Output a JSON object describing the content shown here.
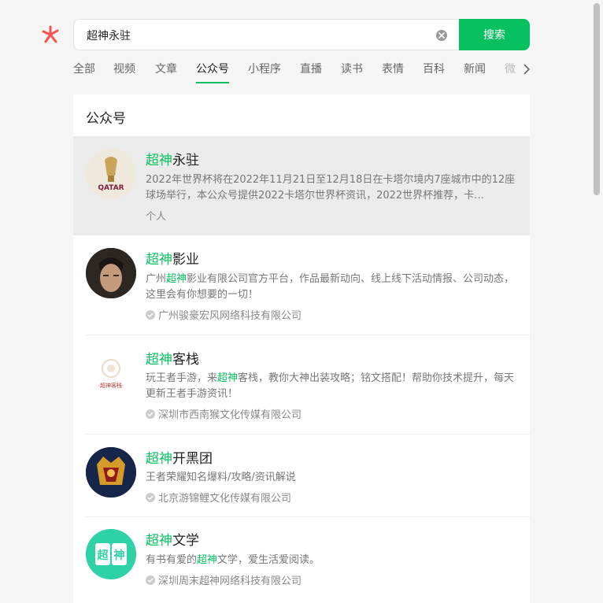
{
  "search": {
    "query": "超神永驻",
    "button_label": "搜索"
  },
  "tabs": [
    {
      "label": "全部"
    },
    {
      "label": "视频"
    },
    {
      "label": "文章"
    },
    {
      "label": "公众号",
      "active": true
    },
    {
      "label": "小程序"
    },
    {
      "label": "直播"
    },
    {
      "label": "读书"
    },
    {
      "label": "表情"
    },
    {
      "label": "百科"
    },
    {
      "label": "新闻"
    },
    {
      "label": "微"
    }
  ],
  "section": {
    "title": "公众号"
  },
  "colors": {
    "accent": "#07c160",
    "logo": "#fa5151"
  },
  "accounts": [
    {
      "hl": "超神",
      "rest": "永驻",
      "desc_before": "2022年世界杯将在2022年11月21日至12月18日在卡塔尔境内7座城市中的12座球场举行，本公众号提供2022卡塔尔世界杯资讯，2022世界杯推荐，卡…",
      "desc_hl": "",
      "desc_after": "",
      "meta": "个人",
      "verified": false,
      "avatar_label": "QATAR"
    },
    {
      "hl": "超神",
      "rest": "影业",
      "desc_before": "广州",
      "desc_hl": "超神",
      "desc_after": "影业有限公司官方平台，作品最新动向、线上线下活动情报、公司动态，这里会有你想要的一切！",
      "meta": "广州骏豪宏风网络科技有限公司",
      "verified": true
    },
    {
      "hl": "超神",
      "rest": "客栈",
      "desc_before": "玩王者手游，来",
      "desc_hl": "超神",
      "desc_after": "客栈，教你大神出装攻略；铭文搭配！帮助你技术提升，每天更新王者手游资讯！",
      "meta": "深圳市西南猴文化传媒有限公司",
      "verified": true,
      "avatar_label": "·超神客栈·"
    },
    {
      "hl": "超神",
      "rest": "开黑团",
      "desc_before": "王者荣耀知名爆料/攻略/资讯解说",
      "desc_hl": "",
      "desc_after": "",
      "meta": "北京游锦鲤文化传媒有限公司",
      "verified": true
    },
    {
      "hl": "超神",
      "rest": "文学",
      "desc_before": "有书有爱的",
      "desc_hl": "超神",
      "desc_after": "文学，爱生活爱阅读。",
      "meta": "深圳周末超神网络科技有限公司",
      "verified": true,
      "avatar_chars": [
        "超",
        "神"
      ]
    }
  ]
}
